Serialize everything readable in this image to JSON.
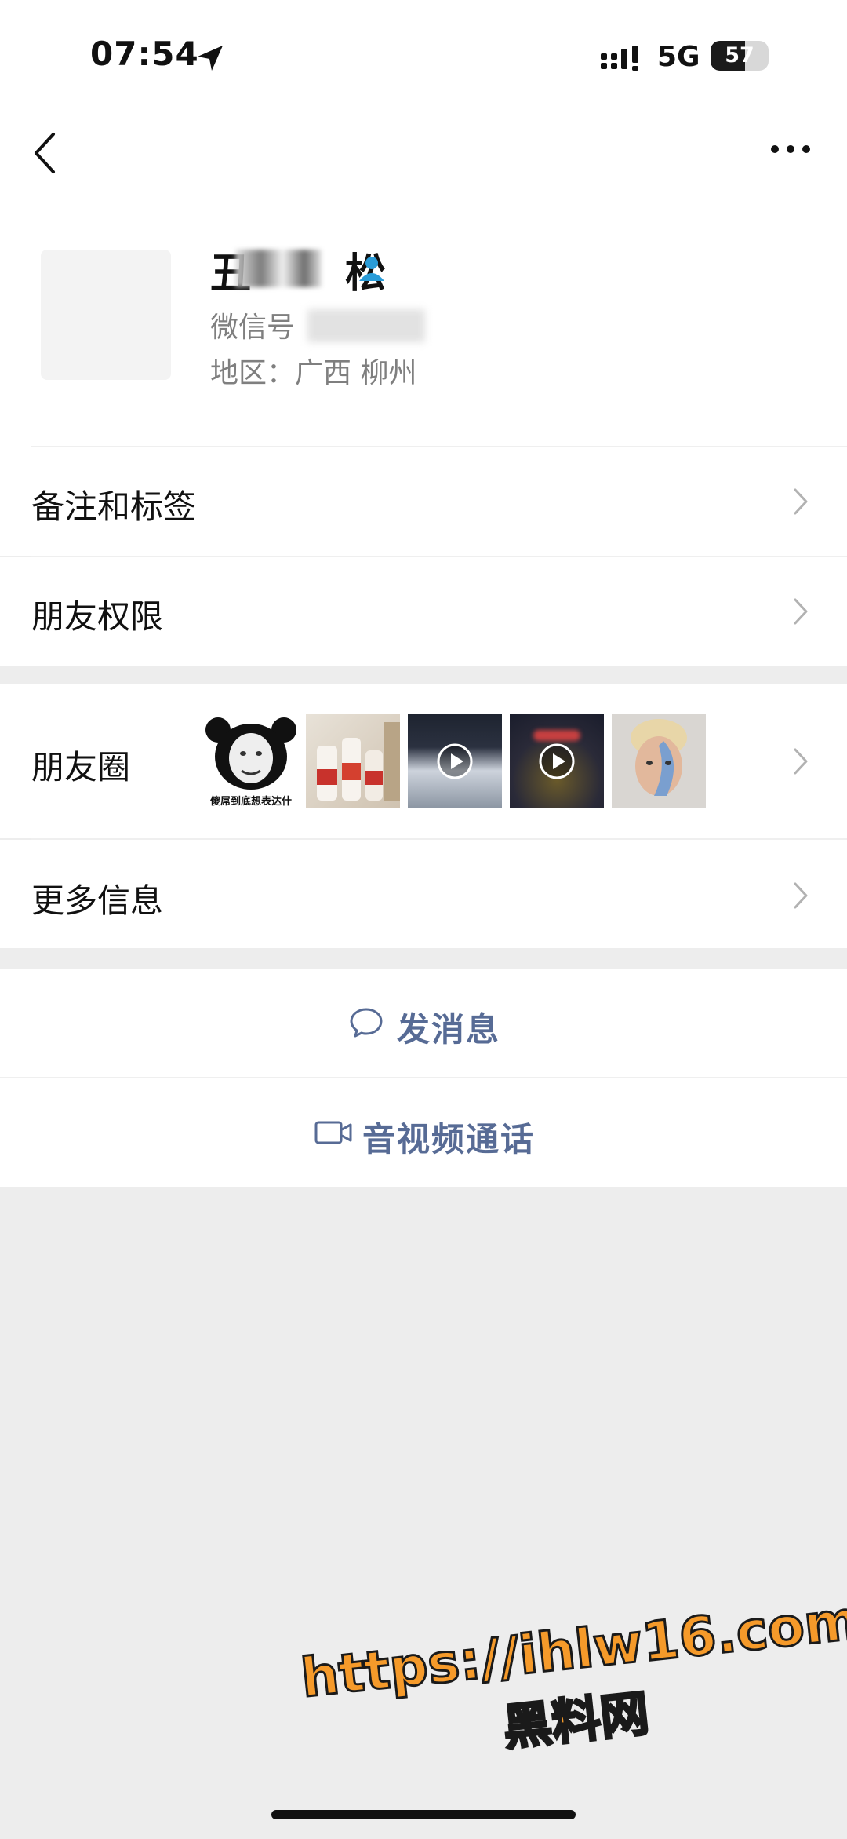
{
  "status_bar": {
    "time": "07:54",
    "network": "5G",
    "battery": "57"
  },
  "profile": {
    "name_prefix": "丑",
    "name_suffix": "松",
    "wechat_id_label": "微信号",
    "region": "地区：广西 柳州"
  },
  "menu": {
    "remark": "备注和标签",
    "permissions": "朋友权限",
    "moments": "朋友圈",
    "more_info": "更多信息"
  },
  "moments_thumbs": {
    "meme_caption": "傻屌到底想表达什"
  },
  "actions": {
    "send_message": "发消息",
    "av_call": "音视频通话"
  },
  "watermark": {
    "url": "https://ihlw16.com",
    "sub": "黑料网"
  },
  "colors": {
    "accent": "#576b95",
    "bg": "#ededed",
    "watermark": "#f59a2a"
  }
}
